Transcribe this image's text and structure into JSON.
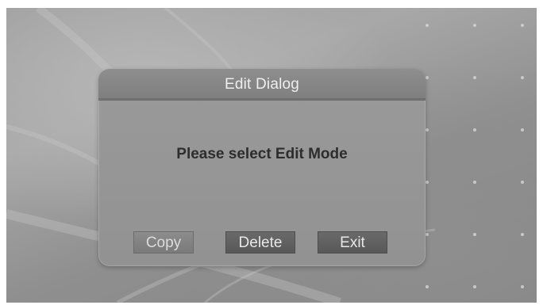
{
  "dialog": {
    "title": "Edit Dialog",
    "message": "Please select Edit Mode",
    "buttons": {
      "copy": "Copy",
      "delete": "Delete",
      "exit": "Exit"
    }
  }
}
